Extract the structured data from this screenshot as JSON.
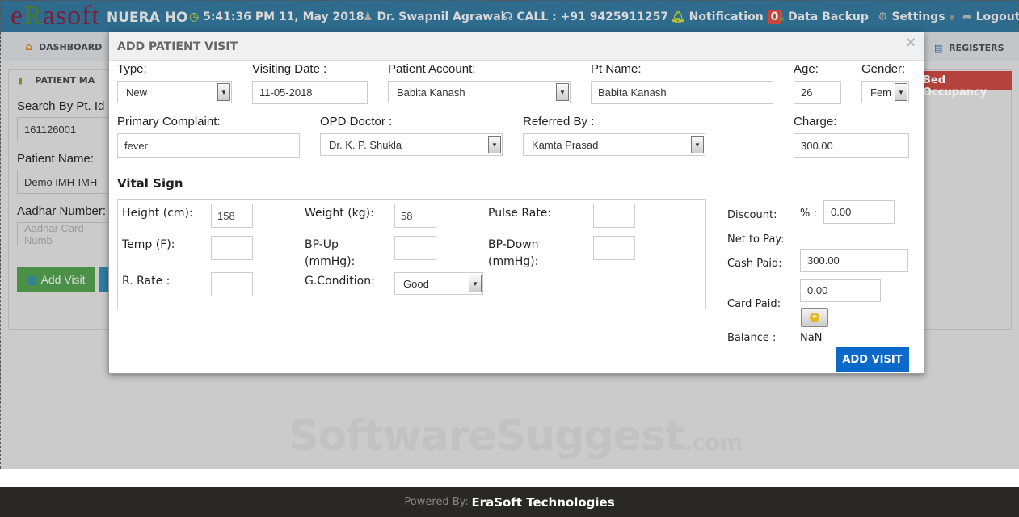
{
  "header": {
    "logo": "eRasoft",
    "hospital": "NUERA HO",
    "datetime": "5:41:36 PM 11, May 2018",
    "user": "Dr. Swapnil Agrawal",
    "call": "CALL : +91 9425911257",
    "notification": "Notification",
    "notification_count": "0",
    "backup": "Data Backup",
    "settings": "Settings",
    "logout": "Logout"
  },
  "nav": {
    "dashboard": "DASHBOARD",
    "registers": "REGISTERS"
  },
  "background_panel": {
    "tab": "PATIENT MA",
    "bed_occupancy": "Bed Occupancy",
    "search_label": "Search By Pt. Id",
    "search_value": "161126001",
    "name_label": "Patient Name:",
    "name_value": "Demo IMH-IMH",
    "aadhar_label": "Aadhar Number:",
    "aadhar_placeholder": "Aadhar Card Numb",
    "add_visit": "Add Visit"
  },
  "modal": {
    "title": "ADD PATIENT VISIT",
    "close": "×",
    "type_label": "Type:",
    "type_value": "New",
    "date_label": "Visiting Date :",
    "date_value": "11-05-2018",
    "account_label": "Patient Account:",
    "account_value": "Babita Kanash",
    "ptname_label": "Pt Name:",
    "ptname_value": "Babita Kanash",
    "age_label": "Age:",
    "age_value": "26",
    "gender_label": "Gender:",
    "gender_value": "Fem",
    "complaint_label": "Primary Complaint:",
    "complaint_value": "fever",
    "doctor_label": "OPD Doctor :",
    "doctor_value": "Dr. K. P. Shukla",
    "referred_label": "Referred By :",
    "referred_value": "Kamta Prasad",
    "charge_label": "Charge:",
    "charge_value": "300.00",
    "vital_title": "Vital Sign",
    "height_label": "Height (cm):",
    "height_value": "158",
    "weight_label": "Weight (kg):",
    "weight_value": "58",
    "pulse_label": "Pulse Rate:",
    "temp_label": "Temp (F):",
    "bpup_label": "BP-Up",
    "bpup_unit": "(mmHg):",
    "bpdown_label": "BP-Down",
    "bpdown_unit": "(mmHg):",
    "rrate_label": "R. Rate :",
    "gcond_label": "G.Condition:",
    "gcond_value": "Good",
    "discount_label": "Discount:",
    "discount_pct": "% :",
    "discount_value": "0.00",
    "net_label": "Net to Pay:",
    "cash_label": "Cash Paid:",
    "cash_value": "300.00",
    "card_label": "Card Paid:",
    "card_value": "0.00",
    "balance_label": "Balance :",
    "balance_value": "NaN",
    "submit": "ADD VISIT"
  },
  "watermark": "SoftwareSuggest",
  "watermark_suffix": ".com",
  "footer": {
    "prefix": "Powered By:",
    "company": "EraSoft Technologies"
  }
}
